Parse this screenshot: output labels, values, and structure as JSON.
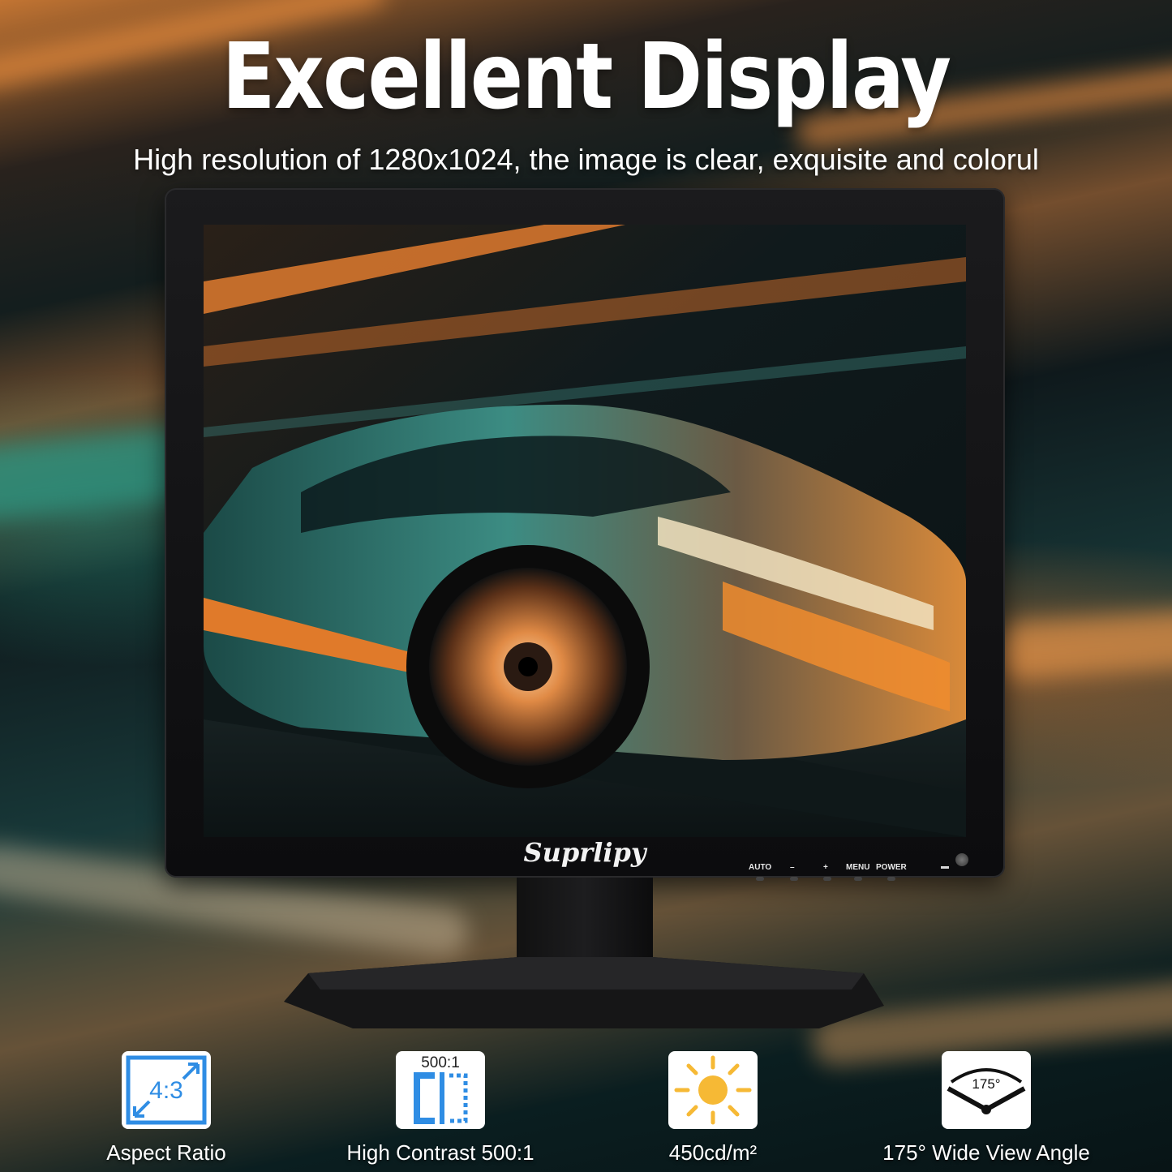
{
  "title": "Excellent Display",
  "subtitle": "High resolution of 1280x1024, the image is clear, exquisite and colorul",
  "monitor": {
    "brand": "Suprlipy",
    "buttons": [
      "AUTO",
      "–",
      "+",
      "MENU",
      "POWER"
    ],
    "screen_image": "sports-car-photo"
  },
  "features": [
    {
      "icon": "aspect-ratio-icon",
      "icon_text": "4:3",
      "label": "Aspect Ratio"
    },
    {
      "icon": "contrast-icon",
      "icon_text": "500:1",
      "label": "High Contrast 500:1"
    },
    {
      "icon": "brightness-sun-icon",
      "label": "450cd/m²"
    },
    {
      "icon": "view-angle-icon",
      "icon_text": "175°",
      "label": "175° Wide View Angle"
    }
  ],
  "colors": {
    "accent_blue": "#2f8de4",
    "sun_yellow": "#f6b935",
    "background_orange": "#e0843a",
    "background_teal": "#1f5a58"
  }
}
